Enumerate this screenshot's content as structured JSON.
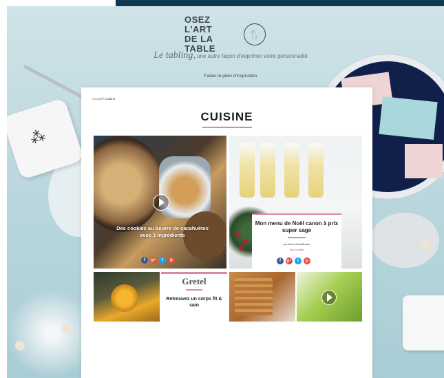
{
  "header": {
    "logo_line1": "OSEZ L'ART",
    "logo_line2": "DE LA TABLE",
    "tagline_lead": "Le tabling,",
    "tagline_rest": " une autre façon d'exprimer votre personnalité",
    "subtitle": "Faites le plein d'inspiration"
  },
  "page": {
    "breadcrumb_home": "Accueil",
    "breadcrumb_current": " / Cuisine",
    "title": "CUISINE",
    "tiles": {
      "cookies_caption": "Des cookies au beurre de cacahuètes avec 3 ingrédients",
      "noel_title": "Mon menu de Noël canon à prix super sage",
      "noel_by": "par Anne Gaudiflouse",
      "noel_more": "Voir la suite",
      "gretel_brand": "Gretel",
      "gretel_text": "Retrouvez un corps fit & sain"
    },
    "share_icons": [
      "f",
      "g+",
      "t",
      "p"
    ]
  },
  "colors": {
    "accent": "#d98aa0",
    "facebook": "#3b5998",
    "google": "#dd4b39",
    "twitter": "#1da1f2",
    "pinterest": "#e74c3c"
  }
}
